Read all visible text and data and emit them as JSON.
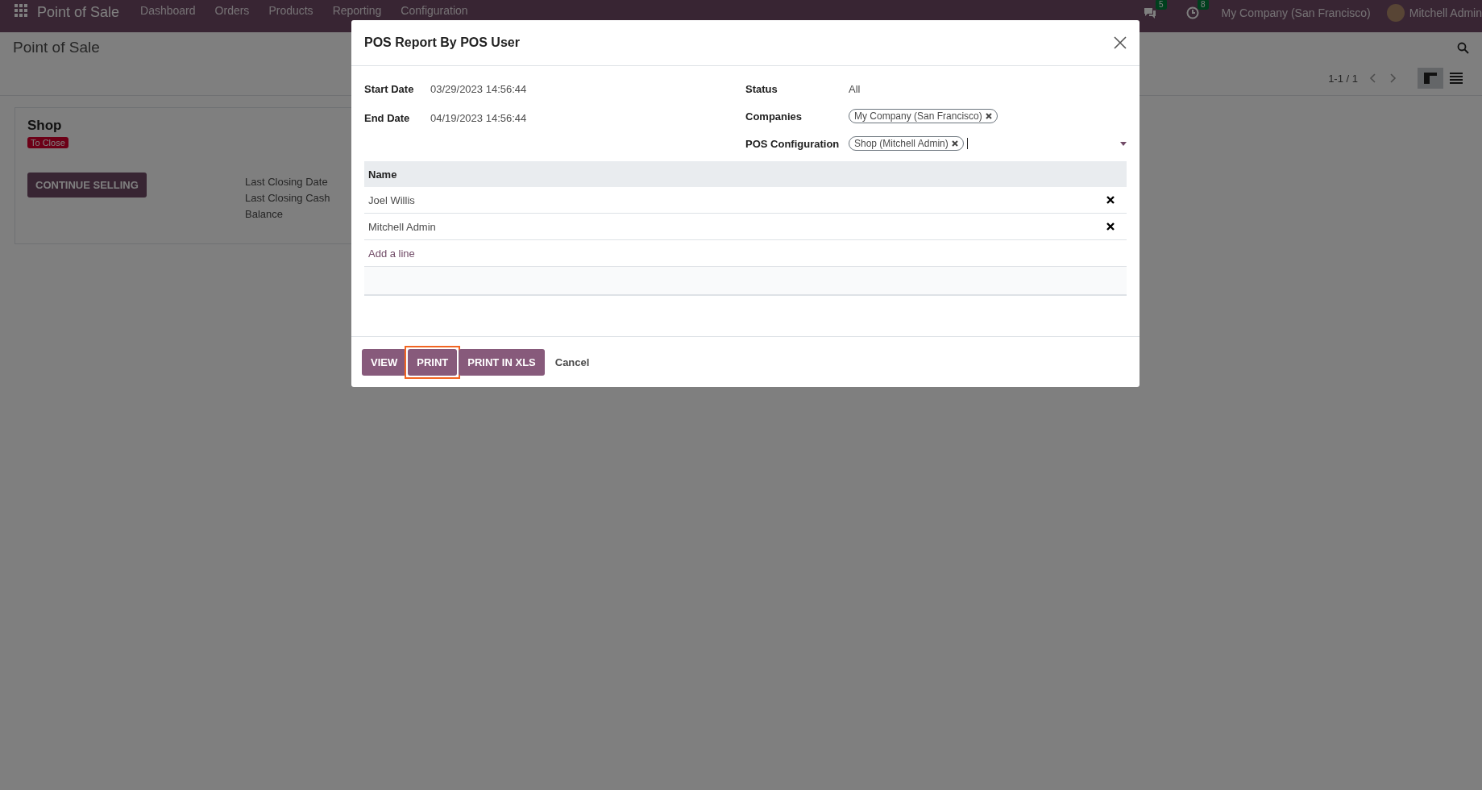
{
  "navbar": {
    "app_name": "Point of Sale",
    "menu": [
      "Dashboard",
      "Orders",
      "Products",
      "Reporting",
      "Configuration"
    ],
    "messages_count": "5",
    "activities_count": "8",
    "company": "My Company (San Francisco)",
    "user": "Mitchell Admin"
  },
  "control_panel": {
    "title": "Point of Sale",
    "pager": "1-1 / 1",
    "views": [
      {
        "kind": "kanban",
        "selected": true
      },
      {
        "kind": "list",
        "selected": false
      }
    ]
  },
  "card": {
    "title": "Shop",
    "badge": "To Close",
    "button": "CONTINUE SELLING",
    "labels": [
      "Last Closing Date",
      "Last Closing Cash",
      "Balance"
    ]
  },
  "dialog": {
    "title": "POS Report By POS User",
    "left_fields": [
      {
        "label": "Start Date",
        "value": "03/29/2023 14:56:44"
      },
      {
        "label": "End Date",
        "value": "04/19/2023 14:56:44"
      }
    ],
    "status": {
      "label": "Status",
      "value": "All"
    },
    "companies": {
      "label": "Companies",
      "tags": [
        "My Company (San Francisco)"
      ]
    },
    "pos_configuration": {
      "label": "POS Configuration",
      "tags": [
        "Shop (Mitchell Admin)"
      ]
    },
    "table": {
      "columns": [
        "Name"
      ],
      "rows": [
        "Joel Willis",
        "Mitchell Admin"
      ],
      "add_line": "Add a line"
    },
    "buttons": [
      {
        "label": "VIEW",
        "kind": "primary",
        "highlighted": false
      },
      {
        "label": "PRINT",
        "kind": "primary",
        "highlighted": true
      },
      {
        "label": "PRINT IN XLS",
        "kind": "primary",
        "highlighted": false
      },
      {
        "label": "Cancel",
        "kind": "secondary",
        "highlighted": false
      }
    ]
  }
}
